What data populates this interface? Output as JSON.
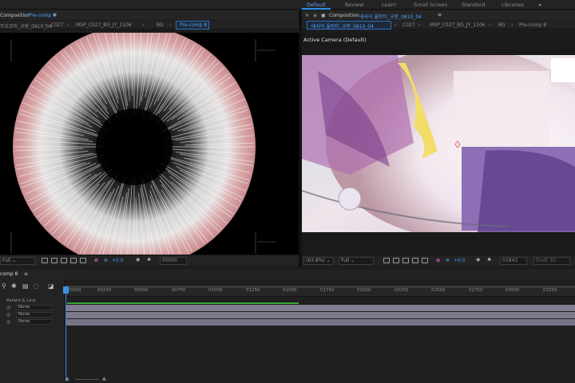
{
  "workspaces": [
    "Default",
    "Review",
    "Learn",
    "Small Screen",
    "Standard",
    "Libraries"
  ],
  "workspace_more": "»",
  "left_panel": {
    "title": "Composition",
    "title_comp": "Pre-comp 8",
    "crumbs": [
      "무오르미_규랑_0810_04",
      "C027",
      "MSP_C027_BG_JY_1106",
      "BG",
      "Pre-comp 8"
    ],
    "zoom_select": "Full",
    "exposure": "+0.0",
    "timecode": "00000"
  },
  "right_panel": {
    "title": "Composition",
    "title_comp": "테사이 율랑티_규랑_0810_04",
    "crumbs": [
      "테사이 율랑티_규랑_0810_04",
      "C027",
      "MSP_C027_BG_JY_1106",
      "BG",
      "Pre-comp 8"
    ],
    "active_camera": "Active Camera (Default)",
    "zoom": "(63.8%)",
    "resolution": "Full",
    "exposure": "+0.0",
    "timecode": "01843",
    "draft": "Draft 3D"
  },
  "timeline": {
    "tab": "comp 8",
    "ticks": [
      "00000",
      "00250",
      "00500",
      "00750",
      "01000",
      "01250",
      "01500",
      "01750",
      "02000",
      "02250",
      "02500",
      "02750",
      "03000",
      "03250"
    ],
    "column_header": "Parent & Link",
    "layers": [
      {
        "parent": "None"
      },
      {
        "parent": "None"
      },
      {
        "parent": "None"
      }
    ]
  },
  "colors": {
    "accent": "#2d8ceb",
    "work_area": "#3aa63a",
    "playhead": "#3b8fe6"
  }
}
